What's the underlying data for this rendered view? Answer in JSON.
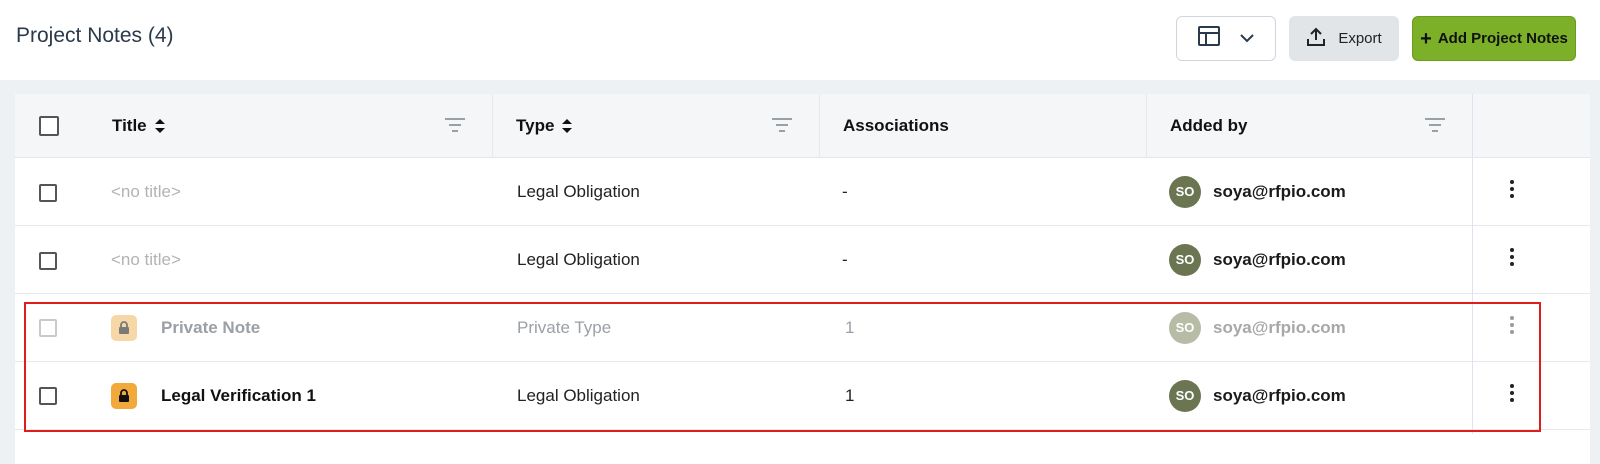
{
  "header": {
    "title": "Project Notes (4)",
    "export_label": "Export",
    "add_label": "Add Project Notes"
  },
  "icons": {
    "view": "table-layout-icon",
    "view_dropdown": "chevron-down-icon",
    "export": "upload-icon",
    "add": "plus-icon",
    "filter": "filter-icon",
    "sort": "sort-icon",
    "lock": "lock-icon",
    "more": "kebab-menu-icon"
  },
  "colors": {
    "add_button": "#7cb028",
    "lock_badge": "#f2a93b",
    "avatar": "#6b7552",
    "highlight": "#e21b1b"
  },
  "table": {
    "columns": [
      "Title",
      "Type",
      "Associations",
      "Added by"
    ],
    "rows": [
      {
        "title": "<no title>",
        "type": "Legal Obligation",
        "associations": "-",
        "avatar": "SO",
        "added_by": "soya@rfpio.com"
      },
      {
        "title": "<no title>",
        "type": "Legal Obligation",
        "associations": "-",
        "avatar": "SO",
        "added_by": "soya@rfpio.com"
      },
      {
        "title": "Private Note",
        "type": "Private Type",
        "associations": "1",
        "avatar": "SO",
        "added_by": "soya@rfpio.com"
      },
      {
        "title": "Legal Verification 1",
        "type": "Legal Obligation",
        "associations": "1",
        "avatar": "SO",
        "added_by": "soya@rfpio.com"
      }
    ]
  }
}
